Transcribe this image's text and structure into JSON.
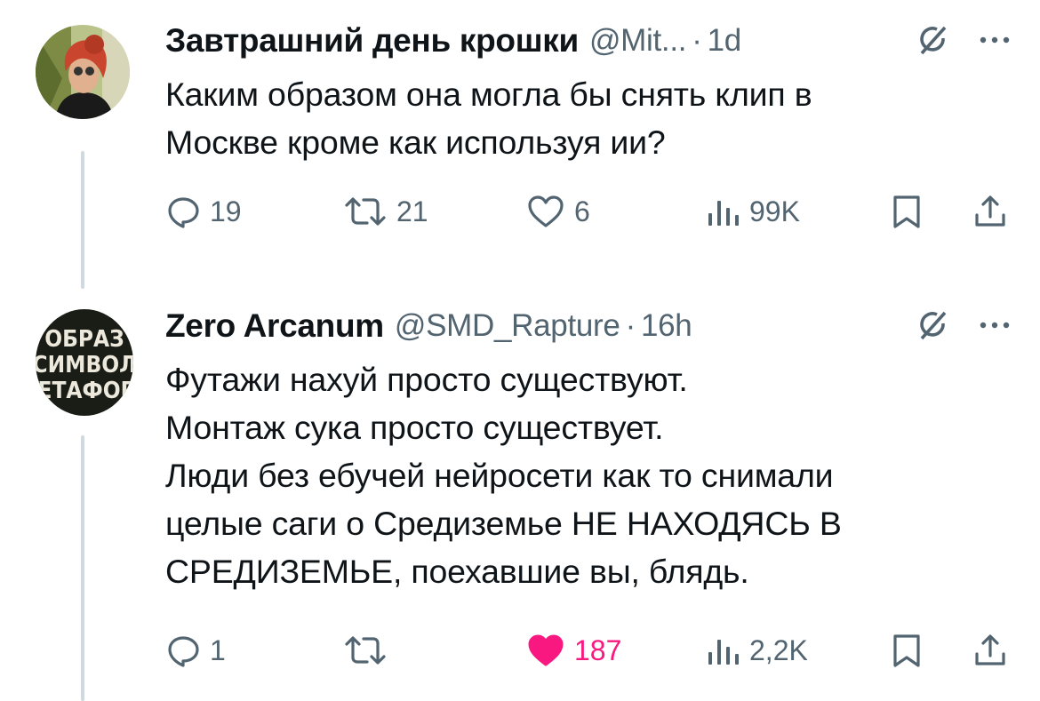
{
  "tweets": [
    {
      "name": "Завтрашний день крошки",
      "handle": "@Mit...",
      "separator": "·",
      "time": "1d",
      "lines": [
        "Каким образом она могла бы снять клип в",
        "Москве кроме как используя ии?"
      ],
      "replies": "19",
      "retweets": "21",
      "likes": "6",
      "views": "99K"
    },
    {
      "name": "Zero Arcanum",
      "handle": "@SMD_Rapture",
      "separator": "·",
      "time": "16h",
      "avatar_text": [
        "ОБРАЗ",
        "СИМВОЛ",
        "МЕТАФОРА"
      ],
      "lines": [
        "Футажи нахуй просто существуют.",
        "Монтаж сука просто существует.",
        "Люди без ебучей нейросети как то снимали",
        "целые саги о Средиземье НЕ НАХОДЯСЬ В",
        "СРЕДИЗЕМЬЕ, поехавшие вы, блядь."
      ],
      "replies": "1",
      "retweets": "",
      "likes": "187",
      "views": "2,2K"
    }
  ],
  "colors": {
    "text": "#0f1419",
    "muted": "#536471",
    "like": "#f91880",
    "thread": "#cfd9de"
  },
  "icons": [
    "reply-icon",
    "retweet-icon",
    "like-icon",
    "views-icon",
    "bookmark-icon",
    "share-icon",
    "grok-icon",
    "more-icon"
  ]
}
